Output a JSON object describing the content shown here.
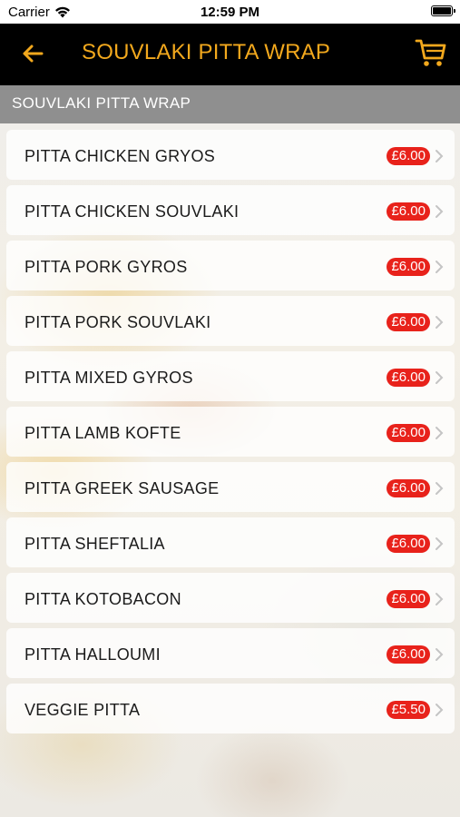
{
  "status_bar": {
    "carrier": "Carrier",
    "time": "12:59 PM",
    "icons": [
      "wifi-icon",
      "battery-icon"
    ]
  },
  "nav": {
    "title": "SOUVLAKI PITTA WRAP",
    "back_icon": "arrow-left-icon",
    "cart_icon": "shopping-cart-icon",
    "accent_color": "#f2a81d",
    "background": "#000000"
  },
  "section": {
    "title": "SOUVLAKI PITTA WRAP"
  },
  "colors": {
    "price_badge": "#e8221b",
    "section_header": "#878787"
  },
  "items": [
    {
      "name": "PITTA CHICKEN GRYOS",
      "price": "£6.00"
    },
    {
      "name": "PITTA CHICKEN SOUVLAKI",
      "price": "£6.00"
    },
    {
      "name": "PITTA PORK GYROS",
      "price": "£6.00"
    },
    {
      "name": "PITTA PORK SOUVLAKI",
      "price": "£6.00"
    },
    {
      "name": "PITTA MIXED GYROS",
      "price": "£6.00"
    },
    {
      "name": "PITTA LAMB KOFTE",
      "price": "£6.00"
    },
    {
      "name": "PITTA GREEK SAUSAGE",
      "price": "£6.00"
    },
    {
      "name": "PITTA SHEFTALIA",
      "price": "£6.00"
    },
    {
      "name": "PITTA KOTOBACON",
      "price": "£6.00"
    },
    {
      "name": "PITTA HALLOUMI",
      "price": "£6.00"
    },
    {
      "name": "VEGGIE PITTA",
      "price": "£5.50"
    }
  ]
}
